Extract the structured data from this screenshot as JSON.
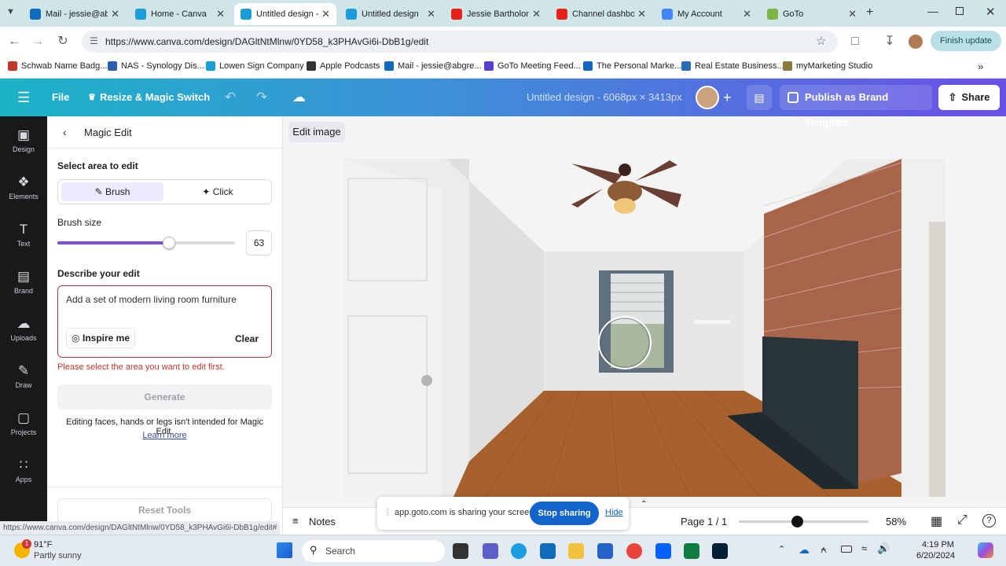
{
  "browser": {
    "tabs": [
      {
        "label": "Mail - jessie@abgre...",
        "color": "#0f6cbd",
        "active": false
      },
      {
        "label": "Home - Canva",
        "color": "#1b9dd9",
        "active": false
      },
      {
        "label": "Untitled design - ",
        "color": "#1b9dd9",
        "active": true
      },
      {
        "label": "Untitled design",
        "color": "#1b9dd9",
        "active": false
      },
      {
        "label": "Jessie Bartholom",
        "color": "#e62117",
        "active": false
      },
      {
        "label": "Channel dashbo",
        "color": "#e62117",
        "active": false
      },
      {
        "label": "My Account",
        "color": "#4285f4",
        "active": false
      },
      {
        "label": "GoTo",
        "color": "#7ab648",
        "active": false
      }
    ],
    "url": "https://www.canva.com/design/DAGltNtMlnw/0YD58_k3PHAvGi6i-DbB1g/edit",
    "finish_update": "Finish update",
    "bookmarks": [
      {
        "label": "Schwab Name Badg...",
        "color": "#c0392b"
      },
      {
        "label": "NAS - Synology Dis...",
        "color": "#2b5fb4"
      },
      {
        "label": "Lowen Sign Company",
        "color": "#1b9dd9"
      },
      {
        "label": "Apple Podcasts",
        "color": "#333333"
      },
      {
        "label": "Mail - jessie@abgre...",
        "color": "#0f6cbd"
      },
      {
        "label": "GoTo Meeting Feed...",
        "color": "#5b3fd1"
      },
      {
        "label": "The Personal Marke...",
        "color": "#1565c0"
      },
      {
        "label": "Real Estate Business...",
        "color": "#2a6cb7"
      },
      {
        "label": "myMarketing Studio",
        "color": "#8a7a3a"
      }
    ]
  },
  "canva": {
    "menu": {
      "file": "File",
      "resize": "Resize & Magic Switch"
    },
    "doc_title": "Untitled design - 6068px × 3413px",
    "publish": "Publish as Brand Template",
    "share": "Share"
  },
  "rail": [
    "Design",
    "Elements",
    "Text",
    "Brand",
    "Uploads",
    "Draw",
    "Projects",
    "Apps"
  ],
  "panel": {
    "title": "Magic Edit",
    "select_area": "Select area to edit",
    "brush": "Brush",
    "click": "Click",
    "brush_size_label": "Brush size",
    "brush_size": "63",
    "brush_fraction": 0.63,
    "describe_label": "Describe your edit",
    "prompt": "Add a set of modern living room furniture",
    "inspire": "Inspire me",
    "clear": "Clear",
    "error": "Please select the area you want to edit first.",
    "generate": "Generate",
    "disclaimer": "Editing faces, hands or legs isn't intended for Magic Edit.",
    "learn_more": "Learn more",
    "reset": "Reset Tools"
  },
  "editor": {
    "edit_image": "Edit image",
    "notes": "Notes",
    "page": "Page 1 / 1",
    "zoom": "58%",
    "zoom_fraction": 0.45
  },
  "screenshare": {
    "message": "app.goto.com is sharing your screen.",
    "stop": "Stop sharing",
    "hide": "Hide"
  },
  "status_url": "https://www.canva.com/design/DAGltNtMlnw/0YD58_k3PHAvGi6i-DbB1g/edit#",
  "taskbar": {
    "weather_temp": "91°F",
    "weather_desc": "Partly sunny",
    "search": "Search",
    "time": "4:19 PM",
    "date": "6/20/2024",
    "notification_count": "1"
  }
}
